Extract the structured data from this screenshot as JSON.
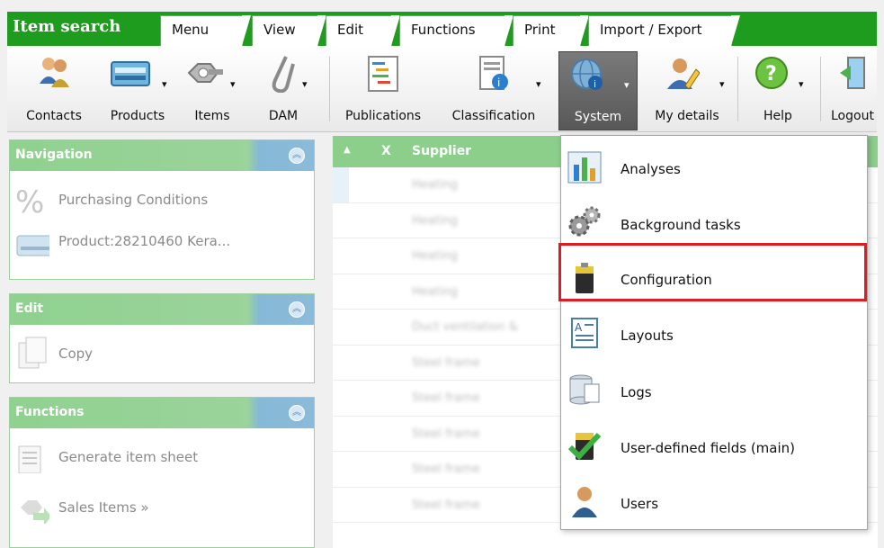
{
  "app": {
    "title": "Item search"
  },
  "tabs": [
    {
      "label": "Menu"
    },
    {
      "label": "View"
    },
    {
      "label": "Edit"
    },
    {
      "label": "Functions"
    },
    {
      "label": "Print"
    },
    {
      "label": "Import / Export"
    }
  ],
  "ribbon": {
    "buttons": [
      {
        "label": "Contacts",
        "icon": "contacts-icon"
      },
      {
        "label": "Products",
        "icon": "products-icon"
      },
      {
        "label": "Items",
        "icon": "items-icon"
      },
      {
        "label": "DAM",
        "icon": "dam-icon"
      },
      {
        "label": "Publications",
        "icon": "publications-icon"
      },
      {
        "label": "Classification",
        "icon": "classification-icon"
      },
      {
        "label": "System",
        "icon": "system-icon"
      },
      {
        "label": "My details",
        "icon": "my-details-icon"
      },
      {
        "label": "Help",
        "icon": "help-icon"
      },
      {
        "label": "Logout",
        "icon": "logout-icon"
      }
    ]
  },
  "panels": {
    "navigation": {
      "title": "Navigation",
      "items": [
        {
          "label": "Purchasing Conditions"
        },
        {
          "label": "Product:28210460 Kera..."
        }
      ]
    },
    "edit": {
      "title": "Edit",
      "items": [
        {
          "label": "Copy"
        }
      ]
    },
    "functions": {
      "title": "Functions",
      "items": [
        {
          "label": "Generate item sheet"
        },
        {
          "label": "Sales Items »"
        }
      ]
    }
  },
  "grid": {
    "columns": {
      "sort": "▲",
      "x": "X",
      "supplier": "Supplier"
    },
    "rows": [
      "Heating",
      "Heating",
      "Heating",
      "Heating",
      "Duct ventilation &",
      "Steel frame",
      "Steel frame",
      "Steel frame",
      "Steel frame",
      "Steel frame"
    ]
  },
  "system_menu": {
    "items": [
      {
        "label": "Analyses",
        "icon": "analyses-icon"
      },
      {
        "label": "Background tasks",
        "icon": "gears-icon"
      },
      {
        "label": "Configuration",
        "icon": "battery-icon"
      },
      {
        "label": "Layouts",
        "icon": "layout-icon"
      },
      {
        "label": "Logs",
        "icon": "logs-icon"
      },
      {
        "label": "User-defined fields (main)",
        "icon": "check-icon"
      },
      {
        "label": "Users",
        "icon": "user-icon"
      }
    ],
    "highlighted": "Configuration"
  },
  "colors": {
    "tab_strip": "#1e9c1e",
    "panel_header": "#8fd18f",
    "highlight_border": "#e11b22",
    "system_selected": "#5e5e5e"
  }
}
